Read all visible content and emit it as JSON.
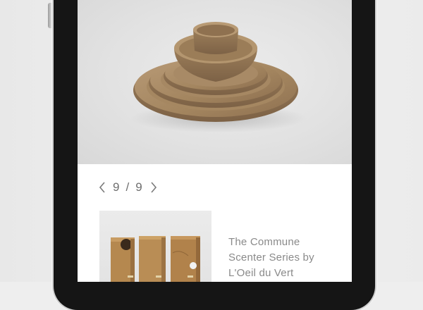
{
  "pager": {
    "current": "9",
    "separator": "/",
    "total": "9",
    "prev_icon": "chevron-left-icon",
    "next_icon": "chevron-right-icon"
  },
  "hero": {
    "image_icon": "stacked-ceramic-dinnerware"
  },
  "related": {
    "thumb_icon": "wooden-scent-boxes",
    "caption_lines": [
      "The Commune",
      "Scenter Series by",
      "L'Oeil du Vert"
    ]
  },
  "colors": {
    "ceramic": "#a88a66",
    "wood": "#b98a52",
    "text": "#8a8a8a",
    "phone": "#151515"
  }
}
